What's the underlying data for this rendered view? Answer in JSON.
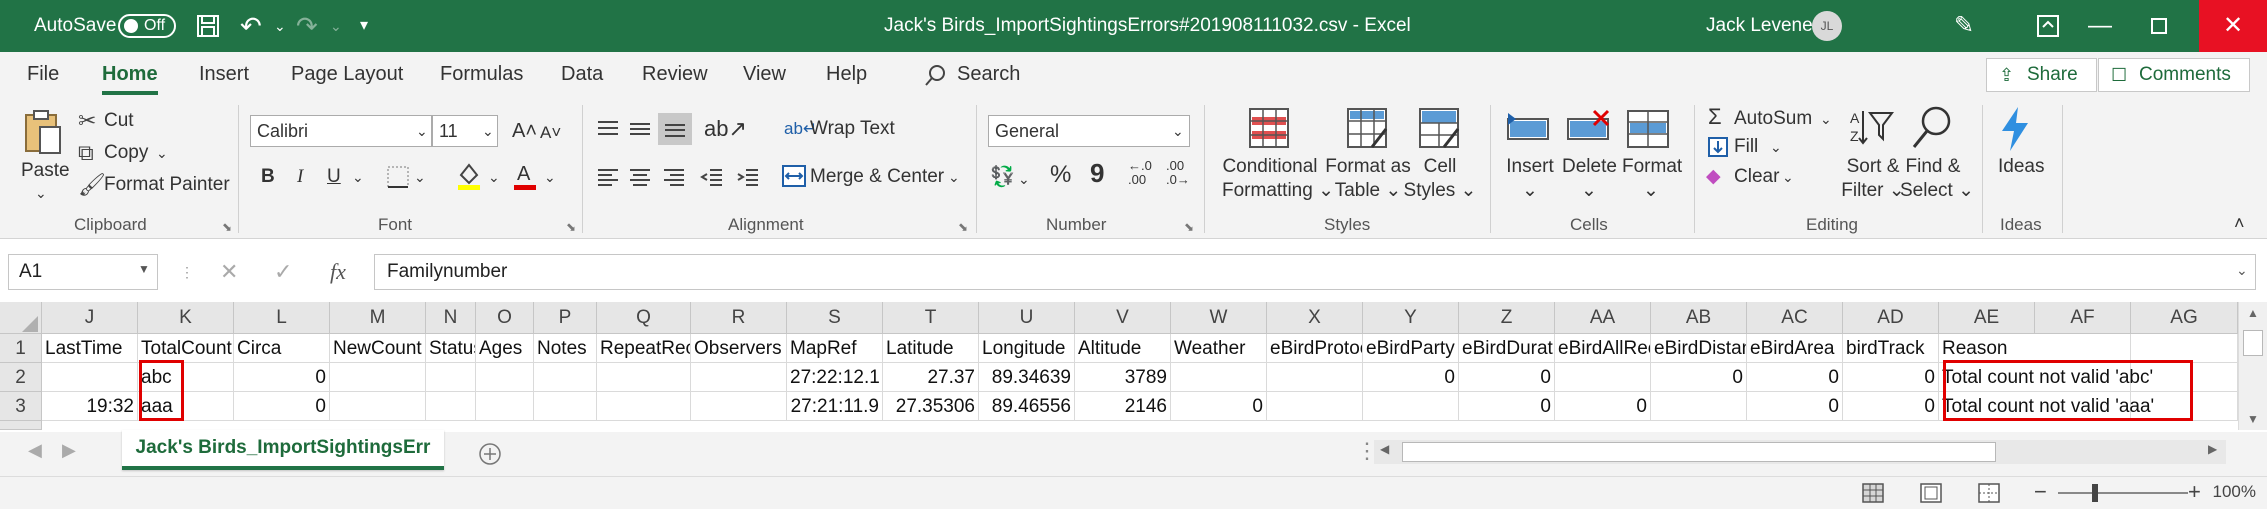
{
  "titlebar": {
    "autosave_label": "AutoSave",
    "autosave_state": "Off",
    "title": "Jack's Birds_ImportSightingsErrors#201908111032.csv  -  Excel",
    "user_name": "Jack Levene",
    "user_initials": "JL"
  },
  "tabs": [
    "File",
    "Home",
    "Insert",
    "Page Layout",
    "Formulas",
    "Data",
    "Review",
    "View",
    "Help"
  ],
  "search_label": "Search",
  "share_label": "Share",
  "comments_label": "Comments",
  "ribbon": {
    "clipboard": {
      "paste": "Paste",
      "cut": "Cut",
      "copy": "Copy",
      "format_painter": "Format Painter",
      "group": "Clipboard"
    },
    "font": {
      "name": "Calibri",
      "size": "11",
      "bold": "B",
      "italic": "I",
      "underline": "U",
      "group": "Font"
    },
    "alignment": {
      "wrap_text": "Wrap Text",
      "merge_center": "Merge & Center",
      "group": "Alignment"
    },
    "number": {
      "format": "General",
      "percent": "%",
      "comma": "9",
      "inc_decimal": ".00",
      "dec_decimal": ".0",
      "group": "Number"
    },
    "styles": {
      "conditional": "Conditional",
      "formatting": "Formatting",
      "format_as": "Format as",
      "table": "Table",
      "cell": "Cell",
      "styles": "Styles",
      "group": "Styles"
    },
    "cells": {
      "insert": "Insert",
      "delete": "Delete",
      "format": "Format",
      "group": "Cells"
    },
    "editing": {
      "autosum": "AutoSum",
      "fill": "Fill",
      "clear": "Clear",
      "sort": "Sort &",
      "filter": "Filter",
      "find": "Find &",
      "select": "Select",
      "group": "Editing"
    },
    "ideas": {
      "label": "Ideas",
      "group": "Ideas"
    }
  },
  "formula_bar": {
    "name_box": "A1",
    "fx": "fx",
    "content": "Familynumber"
  },
  "columns": [
    "J",
    "K",
    "L",
    "M",
    "N",
    "O",
    "P",
    "Q",
    "R",
    "S",
    "T",
    "U",
    "V",
    "W",
    "X",
    "Y",
    "Z",
    "AA",
    "AB",
    "AC",
    "AD",
    "AE",
    "AF",
    "AG"
  ],
  "rows": [
    {
      "num": "1",
      "cells": [
        "LastTime",
        "TotalCount",
        "Circa",
        "NewCount",
        "Status",
        "Ages",
        "Notes",
        "RepeatRecord",
        "Observers",
        "MapRef",
        "Latitude",
        "Longitude",
        "Altitude",
        "Weather",
        "eBirdProtocol",
        "eBirdParty",
        "eBirdDuration",
        "eBirdAllRecorded",
        "eBirdDistance",
        "eBirdArea",
        "birdTrack",
        "Reason",
        "",
        ""
      ]
    },
    {
      "num": "2",
      "cells": [
        "",
        "abc",
        "0",
        "",
        "",
        "",
        "",
        "",
        "",
        "27:22:12.1",
        "27.37",
        "89.34639",
        "3789",
        "",
        "",
        "0",
        "0",
        "",
        "0",
        "0",
        "0",
        "Total count not valid 'abc'",
        "",
        ""
      ]
    },
    {
      "num": "3",
      "cells": [
        "19:32",
        "aaa",
        "0",
        "",
        "",
        "",
        "",
        "",
        "",
        "27:21:11.9",
        "27.35306",
        "89.46556",
        "2146",
        "0",
        "",
        "",
        "0",
        "0",
        "",
        "0",
        "0",
        "Total count not valid 'aaa'",
        "",
        ""
      ]
    }
  ],
  "sheet_tab": "Jack's Birds_ImportSightingsErr",
  "zoom": "100%"
}
